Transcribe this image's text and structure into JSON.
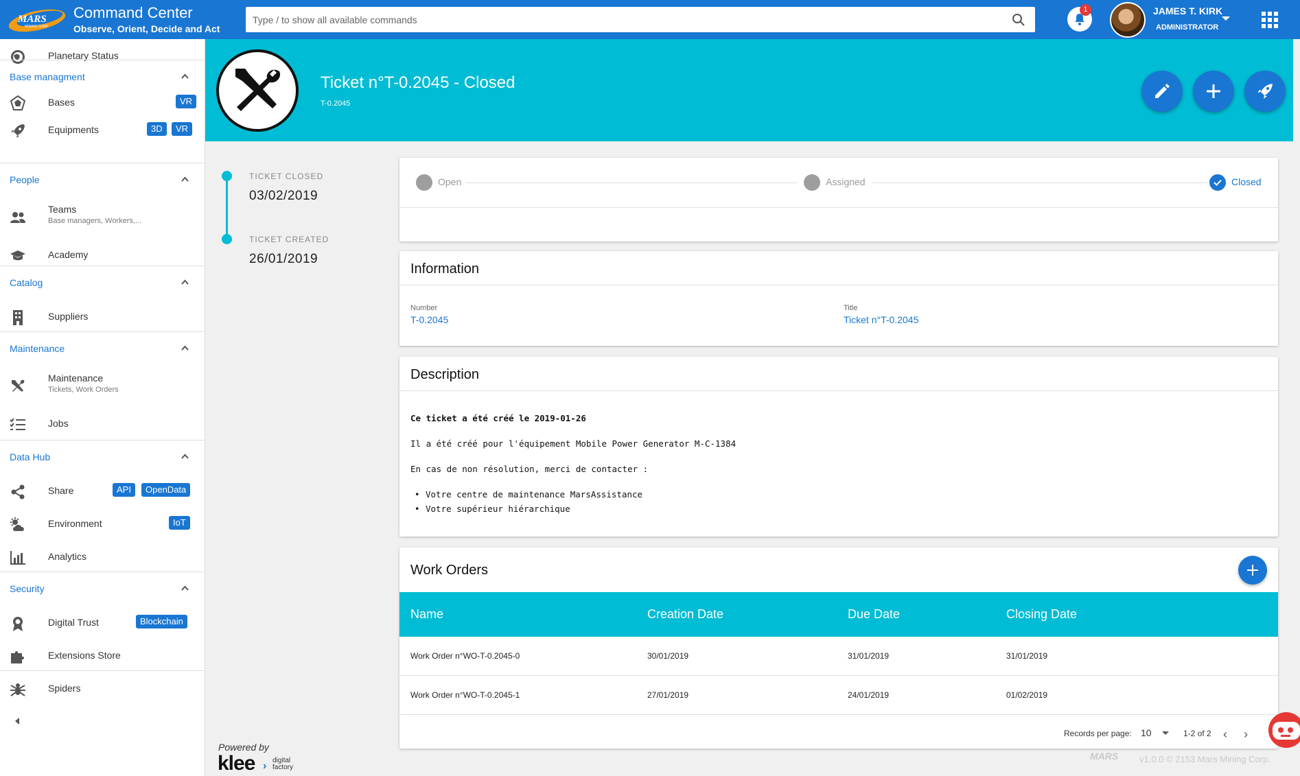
{
  "topbar": {
    "logo_text": "MARS",
    "logo_sub": "MINING CORP",
    "title": "Command Center",
    "subtitle": "Observe, Orient, Decide and Act",
    "search_placeholder": "Type / to show all available commands",
    "notification_count": "1",
    "user_name": "JAMES T. KIRK",
    "user_role": "ADMINISTRATOR",
    "accent": "#1976d2"
  },
  "sidebar": {
    "planetary_status": "Planetary Status",
    "sections": {
      "base": "Base managment",
      "people": "People",
      "catalog": "Catalog",
      "maintenance": "Maintenance",
      "datahub": "Data Hub",
      "security": "Security"
    },
    "items": {
      "bases": {
        "label": "Bases",
        "tags": [
          "VR"
        ]
      },
      "equipments": {
        "label": "Equipments",
        "tags": [
          "3D",
          "VR"
        ]
      },
      "teams": {
        "label": "Teams",
        "sub": "Base managers, Workers,..."
      },
      "academy": {
        "label": "Academy"
      },
      "suppliers": {
        "label": "Suppliers"
      },
      "maintenance": {
        "label": "Maintenance",
        "sub": "Tickets, Work Orders"
      },
      "jobs": {
        "label": "Jobs"
      },
      "share": {
        "label": "Share",
        "tags": [
          "API",
          "OpenData"
        ]
      },
      "environment": {
        "label": "Environment",
        "tags": [
          "IoT"
        ]
      },
      "analytics": {
        "label": "Analytics"
      },
      "digital_trust": {
        "label": "Digital Trust",
        "tags": [
          "Blockchain"
        ]
      },
      "extensions": {
        "label": "Extensions Store"
      },
      "spiders": {
        "label": "Spiders"
      }
    },
    "icons": [
      "planet-icon",
      "dodecahedron-icon",
      "rocket-icon",
      "people-icon",
      "graduation-cap-icon",
      "building-icon",
      "tools-icon",
      "checklist-icon",
      "share-icon",
      "weather-icon",
      "bar-chart-icon",
      "award-icon",
      "puzzle-icon",
      "spider-icon"
    ]
  },
  "hero": {
    "title": "Ticket n°T-0.2045 - Closed",
    "id": "T-0.2045",
    "color": "#00bcd4"
  },
  "timeline": [
    {
      "label": "TICKET CLOSED",
      "date": "03/02/2019"
    },
    {
      "label": "TICKET CREATED",
      "date": "26/01/2019"
    }
  ],
  "powered_by": {
    "label": "Powered by",
    "brand": "klee",
    "brand_sub": "digital factory"
  },
  "steps": [
    {
      "label": "Open",
      "state": "inactive"
    },
    {
      "label": "Assigned",
      "state": "inactive"
    },
    {
      "label": "Closed",
      "state": "done"
    }
  ],
  "information": {
    "title": "Information",
    "number_label": "Number",
    "number_value": "T-0.2045",
    "title_label": "Title",
    "title_value": "Ticket n°T-0.2045"
  },
  "description": {
    "title": "Description",
    "heading": "Ce ticket a été créé le 2019-01-26",
    "line1": "Il a été créé pour l'équipement Mobile Power Generator M-C-1384",
    "line2": "En cas de non résolution, merci de contacter :",
    "bullets": [
      "Votre centre de maintenance MarsAssistance",
      "Votre supérieur hiérarchique"
    ]
  },
  "work_orders": {
    "title": "Work Orders",
    "columns": [
      "Name",
      "Creation Date",
      "Due Date",
      "Closing Date"
    ],
    "rows": [
      [
        "Work Order n°WO-T-0.2045-0",
        "30/01/2019",
        "31/01/2019",
        "31/01/2019"
      ],
      [
        "Work Order n°WO-T-0.2045-1",
        "27/01/2019",
        "24/01/2019",
        "01/02/2019"
      ]
    ],
    "records_per_page_label": "Records per page:",
    "records_per_page": "10",
    "range": "1-2 of 2"
  },
  "footer": {
    "logo": "MARS",
    "version": "v1.0.0 © 2153 Mars Mining Corp."
  }
}
